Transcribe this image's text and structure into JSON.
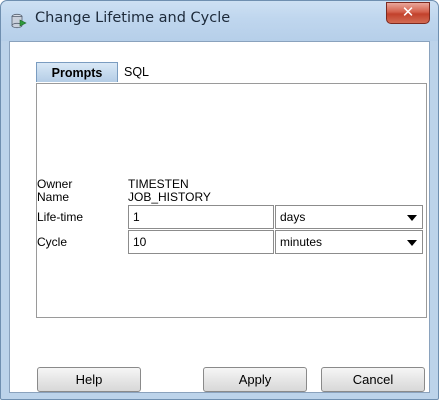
{
  "window": {
    "title": "Change Lifetime and Cycle",
    "close_glyph": "✕"
  },
  "tabs": [
    {
      "label": "Prompts",
      "active": true
    },
    {
      "label": "SQL",
      "active": false
    }
  ],
  "form": {
    "owner_label": "Owner",
    "owner_value": "TIMESTEN",
    "name_label": "Name",
    "name_value": "JOB_HISTORY",
    "lifetime_label": "Life-time",
    "lifetime_value": "1",
    "lifetime_unit": "days",
    "cycle_label": "Cycle",
    "cycle_value": "10",
    "cycle_unit": "minutes"
  },
  "buttons": {
    "help_label": "Help",
    "apply_label": "Apply",
    "cancel_label": "Cancel"
  }
}
